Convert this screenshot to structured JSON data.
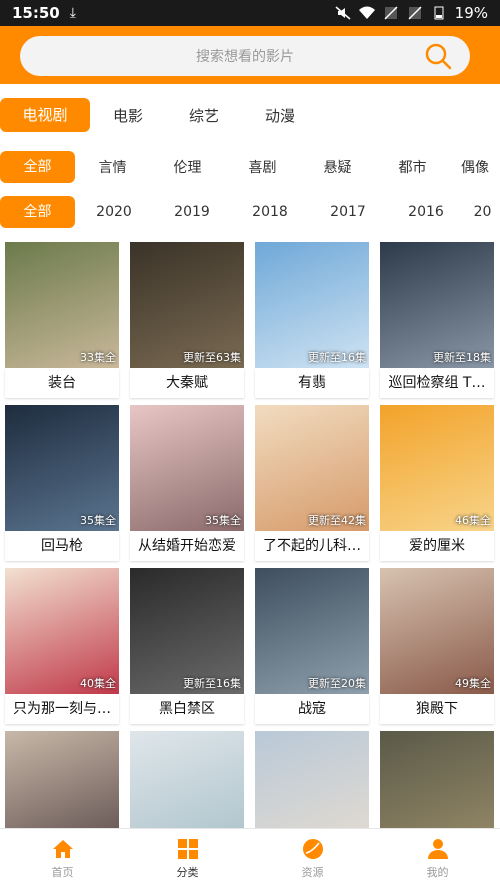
{
  "status": {
    "time": "15:50",
    "battery": "19%"
  },
  "search": {
    "placeholder": "搜索想看的影片"
  },
  "categories": [
    "电视剧",
    "电影",
    "综艺",
    "动漫"
  ],
  "genres": [
    "全部",
    "言情",
    "伦理",
    "喜剧",
    "悬疑",
    "都市",
    "偶像"
  ],
  "years": [
    "全部",
    "2020",
    "2019",
    "2018",
    "2017",
    "2016",
    "20"
  ],
  "shows": [
    {
      "title": "装台",
      "badge": "33集全",
      "colors": [
        "#6b7a4b",
        "#c9b89a"
      ]
    },
    {
      "title": "大秦赋",
      "badge": "更新至63集",
      "colors": [
        "#3a3328",
        "#7a6a52"
      ]
    },
    {
      "title": "有翡",
      "badge": "更新至16集",
      "colors": [
        "#6fa8d8",
        "#cfe3f2"
      ]
    },
    {
      "title": "巡回检察组 T…",
      "badge": "更新至18集",
      "colors": [
        "#2d3a4a",
        "#8a97a6"
      ]
    },
    {
      "title": "回马枪",
      "badge": "35集全",
      "colors": [
        "#1e2c3e",
        "#5b7590"
      ]
    },
    {
      "title": "从结婚开始恋爱",
      "badge": "35集全",
      "colors": [
        "#e8c6c6",
        "#8a6a6a"
      ]
    },
    {
      "title": "了不起的儿科…",
      "badge": "更新至42集",
      "colors": [
        "#f1dcc0",
        "#d69a6a"
      ]
    },
    {
      "title": "爱的厘米",
      "badge": "46集全",
      "colors": [
        "#f3a32a",
        "#f7d48a"
      ]
    },
    {
      "title": "只为那一刻与…",
      "badge": "40集全",
      "colors": [
        "#f2e1d0",
        "#c0394a"
      ]
    },
    {
      "title": "黑白禁区",
      "badge": "更新至16集",
      "colors": [
        "#2a2a2a",
        "#6a6a6a"
      ]
    },
    {
      "title": "战寇",
      "badge": "更新至20集",
      "colors": [
        "#3e4e5e",
        "#8fa0ad"
      ]
    },
    {
      "title": "狼殿下",
      "badge": "49集全",
      "colors": [
        "#d7c2b0",
        "#8a5a4a"
      ]
    },
    {
      "title": "",
      "badge": "",
      "colors": [
        "#c8b8a8",
        "#5a4a4a"
      ]
    },
    {
      "title": "",
      "badge": "",
      "colors": [
        "#dfe6ea",
        "#a9c0c9"
      ]
    },
    {
      "title": "",
      "badge": "",
      "colors": [
        "#b9c9d8",
        "#e6dcd0"
      ]
    },
    {
      "title": "",
      "badge": "",
      "colors": [
        "#5a5a48",
        "#9a8c6a"
      ]
    }
  ],
  "nav": [
    {
      "label": "首页",
      "icon": "home-icon"
    },
    {
      "label": "分类",
      "icon": "category-icon"
    },
    {
      "label": "资源",
      "icon": "resource-icon"
    },
    {
      "label": "我的",
      "icon": "profile-icon"
    }
  ],
  "colors": {
    "accent": "#ff8a00",
    "inactive": "#999999",
    "active": "#333333"
  }
}
